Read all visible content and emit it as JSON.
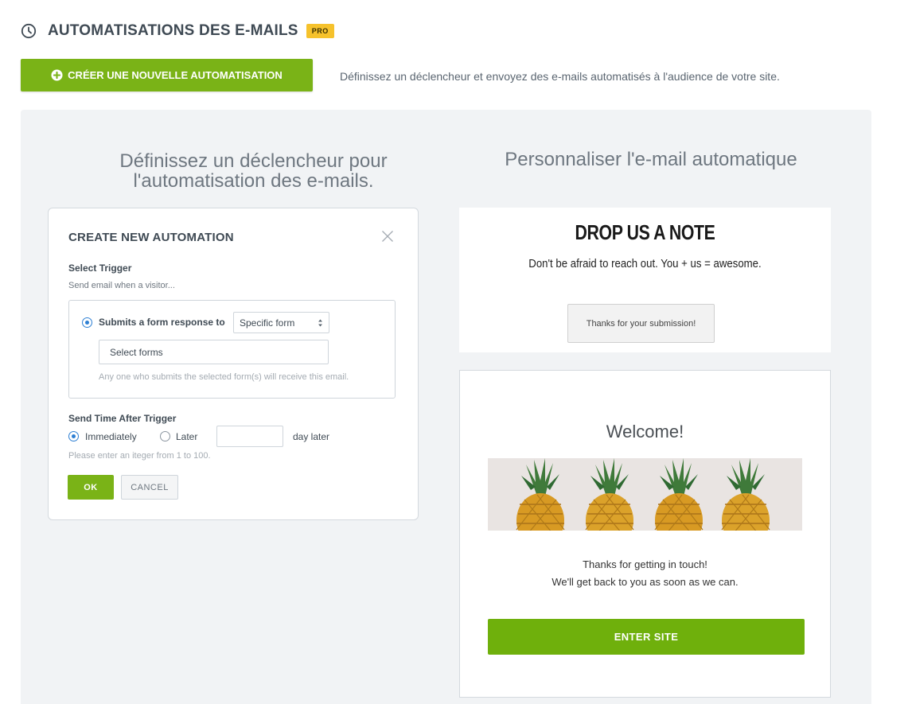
{
  "header": {
    "title": "AUTOMATISATIONS DES E-MAILS",
    "badge": "PRO"
  },
  "toolbar": {
    "create_label": "CRÉER UNE NOUVELLE AUTOMATISATION",
    "description": "Définissez un déclencheur et envoyez des e-mails automatisés à l'audience de votre site."
  },
  "left": {
    "heading_line1": "Définissez un déclencheur pour",
    "heading_line2": "l'automatisation des e-mails."
  },
  "right": {
    "heading": "Personnaliser l'e-mail automatique"
  },
  "modal": {
    "title": "CREATE NEW AUTOMATION",
    "select_trigger_label": "Select Trigger",
    "send_email_when": "Send email when a visitor...",
    "trigger_option_label": "Submits a form response to",
    "form_select_value": "Specific form",
    "forms_input_value": "Select forms",
    "forms_hint": "Any one who submits the selected form(s) will receive this email.",
    "send_time_label": "Send Time After Trigger",
    "immediately_label": "Immediately",
    "later_label": "Later",
    "day_input_value": "",
    "day_later_label": "day later",
    "integer_hint": "Please enter an iteger  from 1 to 100.",
    "ok_label": "OK",
    "cancel_label": "CANCEL"
  },
  "note_preview": {
    "title": "DROP US A NOTE",
    "subtitle": "Don't be afraid to reach out. You + us = awesome.",
    "thanks_button": "Thanks for your submission!"
  },
  "email_preview": {
    "welcome": "Welcome!",
    "body_line1": "Thanks for getting in touch!",
    "body_line2": "We'll get back to you as soon as we can.",
    "button_label": "ENTER SITE"
  },
  "colors": {
    "accent_green": "#7ab317",
    "badge_yellow": "#f6c22c",
    "radio_blue": "#2d7fd3",
    "panel_bg": "#f1f3f5"
  },
  "icons": {
    "header": "clock-icon",
    "create": "plus-circle-icon",
    "close": "close-icon",
    "select": "select-arrows-icon",
    "image": "pineapples-image"
  }
}
